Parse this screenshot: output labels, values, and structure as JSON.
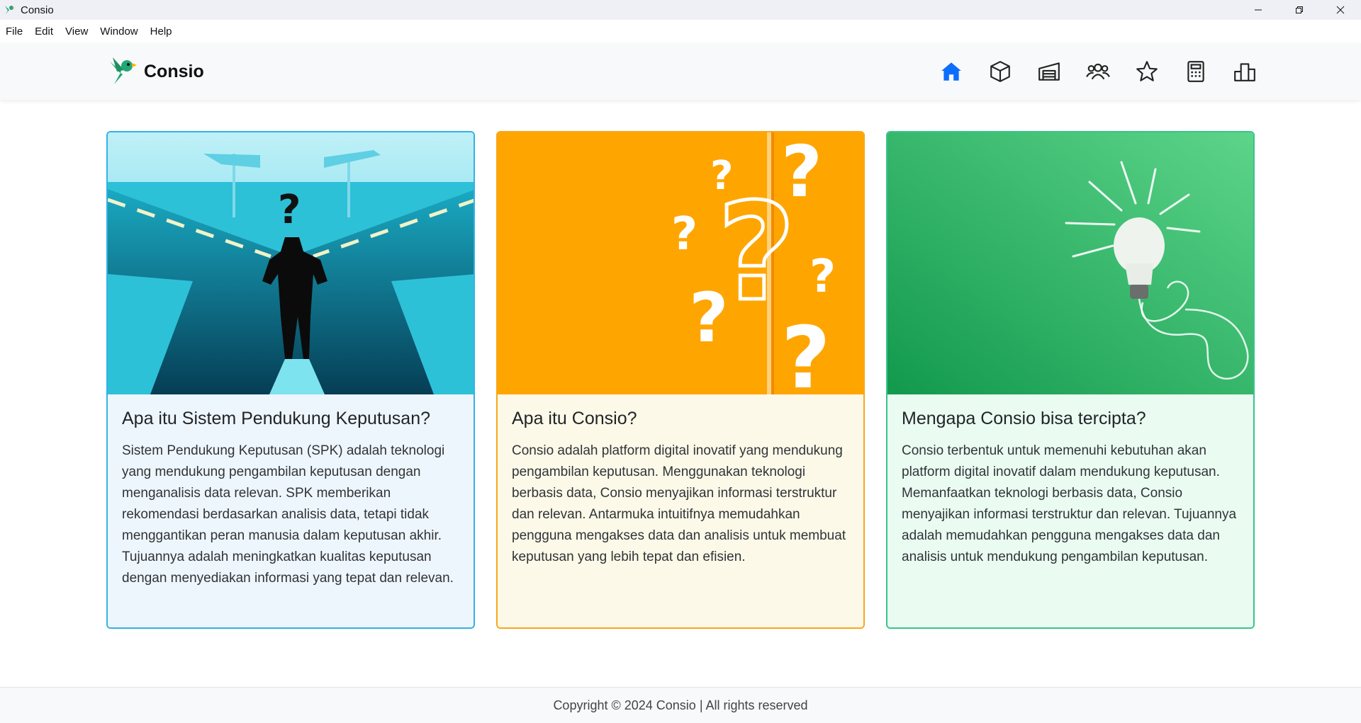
{
  "window": {
    "title": "Consio"
  },
  "menu": {
    "items": [
      "File",
      "Edit",
      "View",
      "Window",
      "Help"
    ]
  },
  "navbar": {
    "brand": "Consio",
    "icons": [
      "home-icon",
      "box-icon",
      "warehouse-icon",
      "people-icon",
      "star-icon",
      "calculator-icon",
      "buildings-icon"
    ],
    "active_color": "#0d6efd"
  },
  "cards": [
    {
      "title": "Apa itu Sistem Pendukung Keputusan?",
      "text": "Sistem Pendukung Keputusan (SPK) adalah teknologi yang mendukung pengambilan keputusan dengan menganalisis data relevan. SPK memberikan rekomendasi berdasarkan analisis data, tetapi tidak menggantikan peran manusia dalam keputusan akhir. Tujuannya adalah meningkatkan kualitas keputusan dengan menyediakan informasi yang tepat dan relevan.",
      "accent": "#32b2e6"
    },
    {
      "title": "Apa itu Consio?",
      "text": "Consio adalah platform digital inovatif yang mendukung pengambilan keputusan. Menggunakan teknologi berbasis data, Consio menyajikan informasi terstruktur dan relevan. Antarmuka intuitifnya memudahkan pengguna mengakses data dan analisis untuk membuat keputusan yang lebih tepat dan efisien.",
      "accent": "#f7a71a"
    },
    {
      "title": "Mengapa Consio bisa tercipta?",
      "text": "Consio terbentuk untuk memenuhi kebutuhan akan platform digital inovatif dalam mendukung keputusan. Memanfaatkan teknologi berbasis data, Consio menyajikan informasi terstruktur dan relevan. Tujuannya adalah memudahkan pengguna mengakses data dan analisis untuk mendukung pengambilan keputusan.",
      "accent": "#37c48b"
    }
  ],
  "footer": {
    "text": "Copyright © 2024 Consio | All rights reserved"
  }
}
